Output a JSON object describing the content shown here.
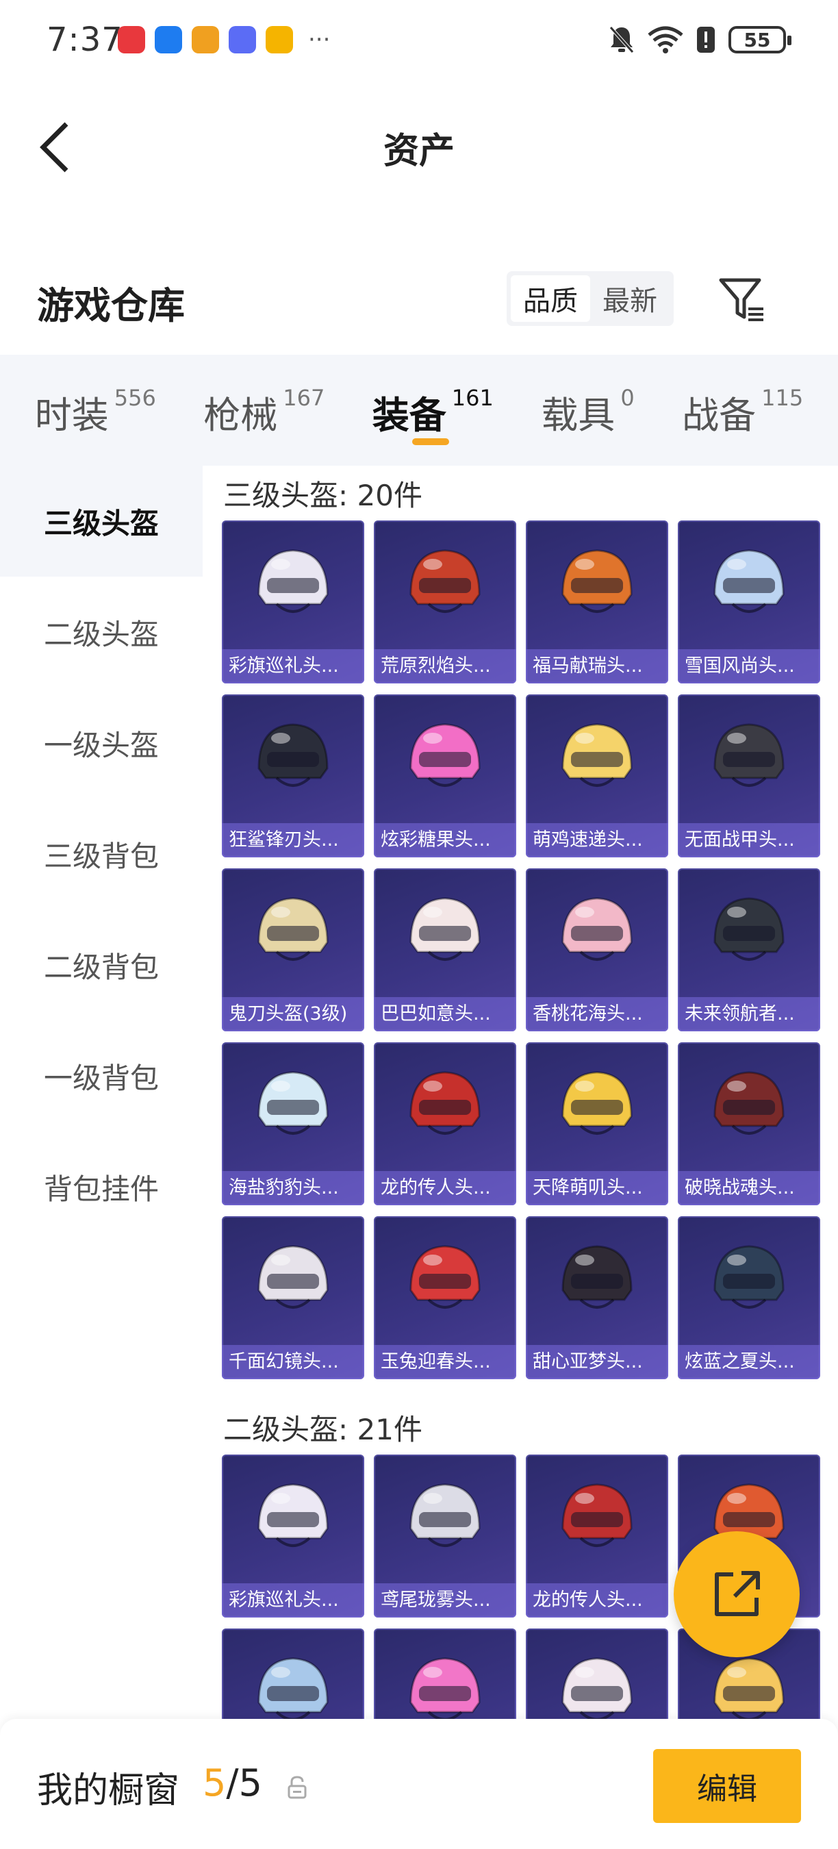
{
  "status_bar": {
    "time": "7:37",
    "battery": "55",
    "app_icons": [
      {
        "name": "huawei-app-icon",
        "color": "#e8383d"
      },
      {
        "name": "app-market-icon",
        "color": "#1e7cf0"
      },
      {
        "name": "music-app-icon",
        "color": "#f0a020"
      },
      {
        "name": "itunes-icon",
        "color": "#5b6cf5"
      },
      {
        "name": "cup-app-icon",
        "color": "#f5b400"
      }
    ],
    "more": "···"
  },
  "nav": {
    "title": "资产"
  },
  "warehouse": {
    "title": "游戏仓库",
    "sort_options": [
      {
        "label": "品质",
        "active": true
      },
      {
        "label": "最新",
        "active": false
      }
    ]
  },
  "tabs": [
    {
      "label": "时装",
      "count": "556",
      "active": false
    },
    {
      "label": "枪械",
      "count": "167",
      "active": false
    },
    {
      "label": "装备",
      "count": "161",
      "active": true
    },
    {
      "label": "载具",
      "count": "0",
      "active": false
    },
    {
      "label": "战备",
      "count": "115",
      "active": false
    }
  ],
  "side_menu": [
    {
      "label": "三级头盔",
      "active": true
    },
    {
      "label": "二级头盔",
      "active": false
    },
    {
      "label": "一级头盔",
      "active": false
    },
    {
      "label": "三级背包",
      "active": false
    },
    {
      "label": "二级背包",
      "active": false
    },
    {
      "label": "一级背包",
      "active": false
    },
    {
      "label": "背包挂件",
      "active": false
    }
  ],
  "sections": [
    {
      "title": "三级头盔: 20件",
      "items": [
        {
          "label": "彩旗巡礼头...",
          "color": "#e9e6f2"
        },
        {
          "label": "荒原烈焰头...",
          "color": "#c8402a"
        },
        {
          "label": "福马献瑞头...",
          "color": "#e0742c"
        },
        {
          "label": "雪国风尚头...",
          "color": "#bcd4f2"
        },
        {
          "label": "狂鲨锋刃头...",
          "color": "#2a2d3a"
        },
        {
          "label": "炫彩糖果头...",
          "color": "#f26ec6"
        },
        {
          "label": "萌鸡速递头...",
          "color": "#f5d36a"
        },
        {
          "label": "无面战甲头...",
          "color": "#3b3b44"
        },
        {
          "label": "鬼刀头盔(3级)",
          "color": "#e6d6a6"
        },
        {
          "label": "巴巴如意头...",
          "color": "#f3e6e6"
        },
        {
          "label": "香桃花海头...",
          "color": "#f2b8c8"
        },
        {
          "label": "未来领航者...",
          "color": "#30353f"
        },
        {
          "label": "海盐豹豹头...",
          "color": "#d6eaf6"
        },
        {
          "label": "龙的传人头...",
          "color": "#c6302c"
        },
        {
          "label": "天降萌叽头...",
          "color": "#f3c846"
        },
        {
          "label": "破晓战魂头...",
          "color": "#7a2a2a"
        },
        {
          "label": "千面幻镜头...",
          "color": "#e6e2ea"
        },
        {
          "label": "玉兔迎春头...",
          "color": "#d83a3a"
        },
        {
          "label": "甜心亚梦头...",
          "color": "#2f2a35"
        },
        {
          "label": "炫蓝之夏头...",
          "color": "#2e4058"
        }
      ]
    },
    {
      "title": "二级头盔: 21件",
      "items": [
        {
          "label": "彩旗巡礼头...",
          "color": "#ece8f4"
        },
        {
          "label": "鸢尾珑雾头...",
          "color": "#dcdce6"
        },
        {
          "label": "龙的传人头...",
          "color": "#c03030"
        },
        {
          "label": "",
          "color": "#e05a30"
        },
        {
          "label": "",
          "color": "#a8c8ea"
        },
        {
          "label": "",
          "color": "#f276c8"
        },
        {
          "label": "",
          "color": "#f0e6ee"
        },
        {
          "label": "",
          "color": "#f5c860"
        }
      ]
    }
  ],
  "bottom_bar": {
    "label": "我的橱窗",
    "used": "5",
    "separator": "/",
    "total": "5",
    "edit_label": "编辑"
  },
  "colors": {
    "accent": "#fbb61a",
    "tab_indicator": "#f5a623",
    "card_bg": "#3a3483"
  }
}
